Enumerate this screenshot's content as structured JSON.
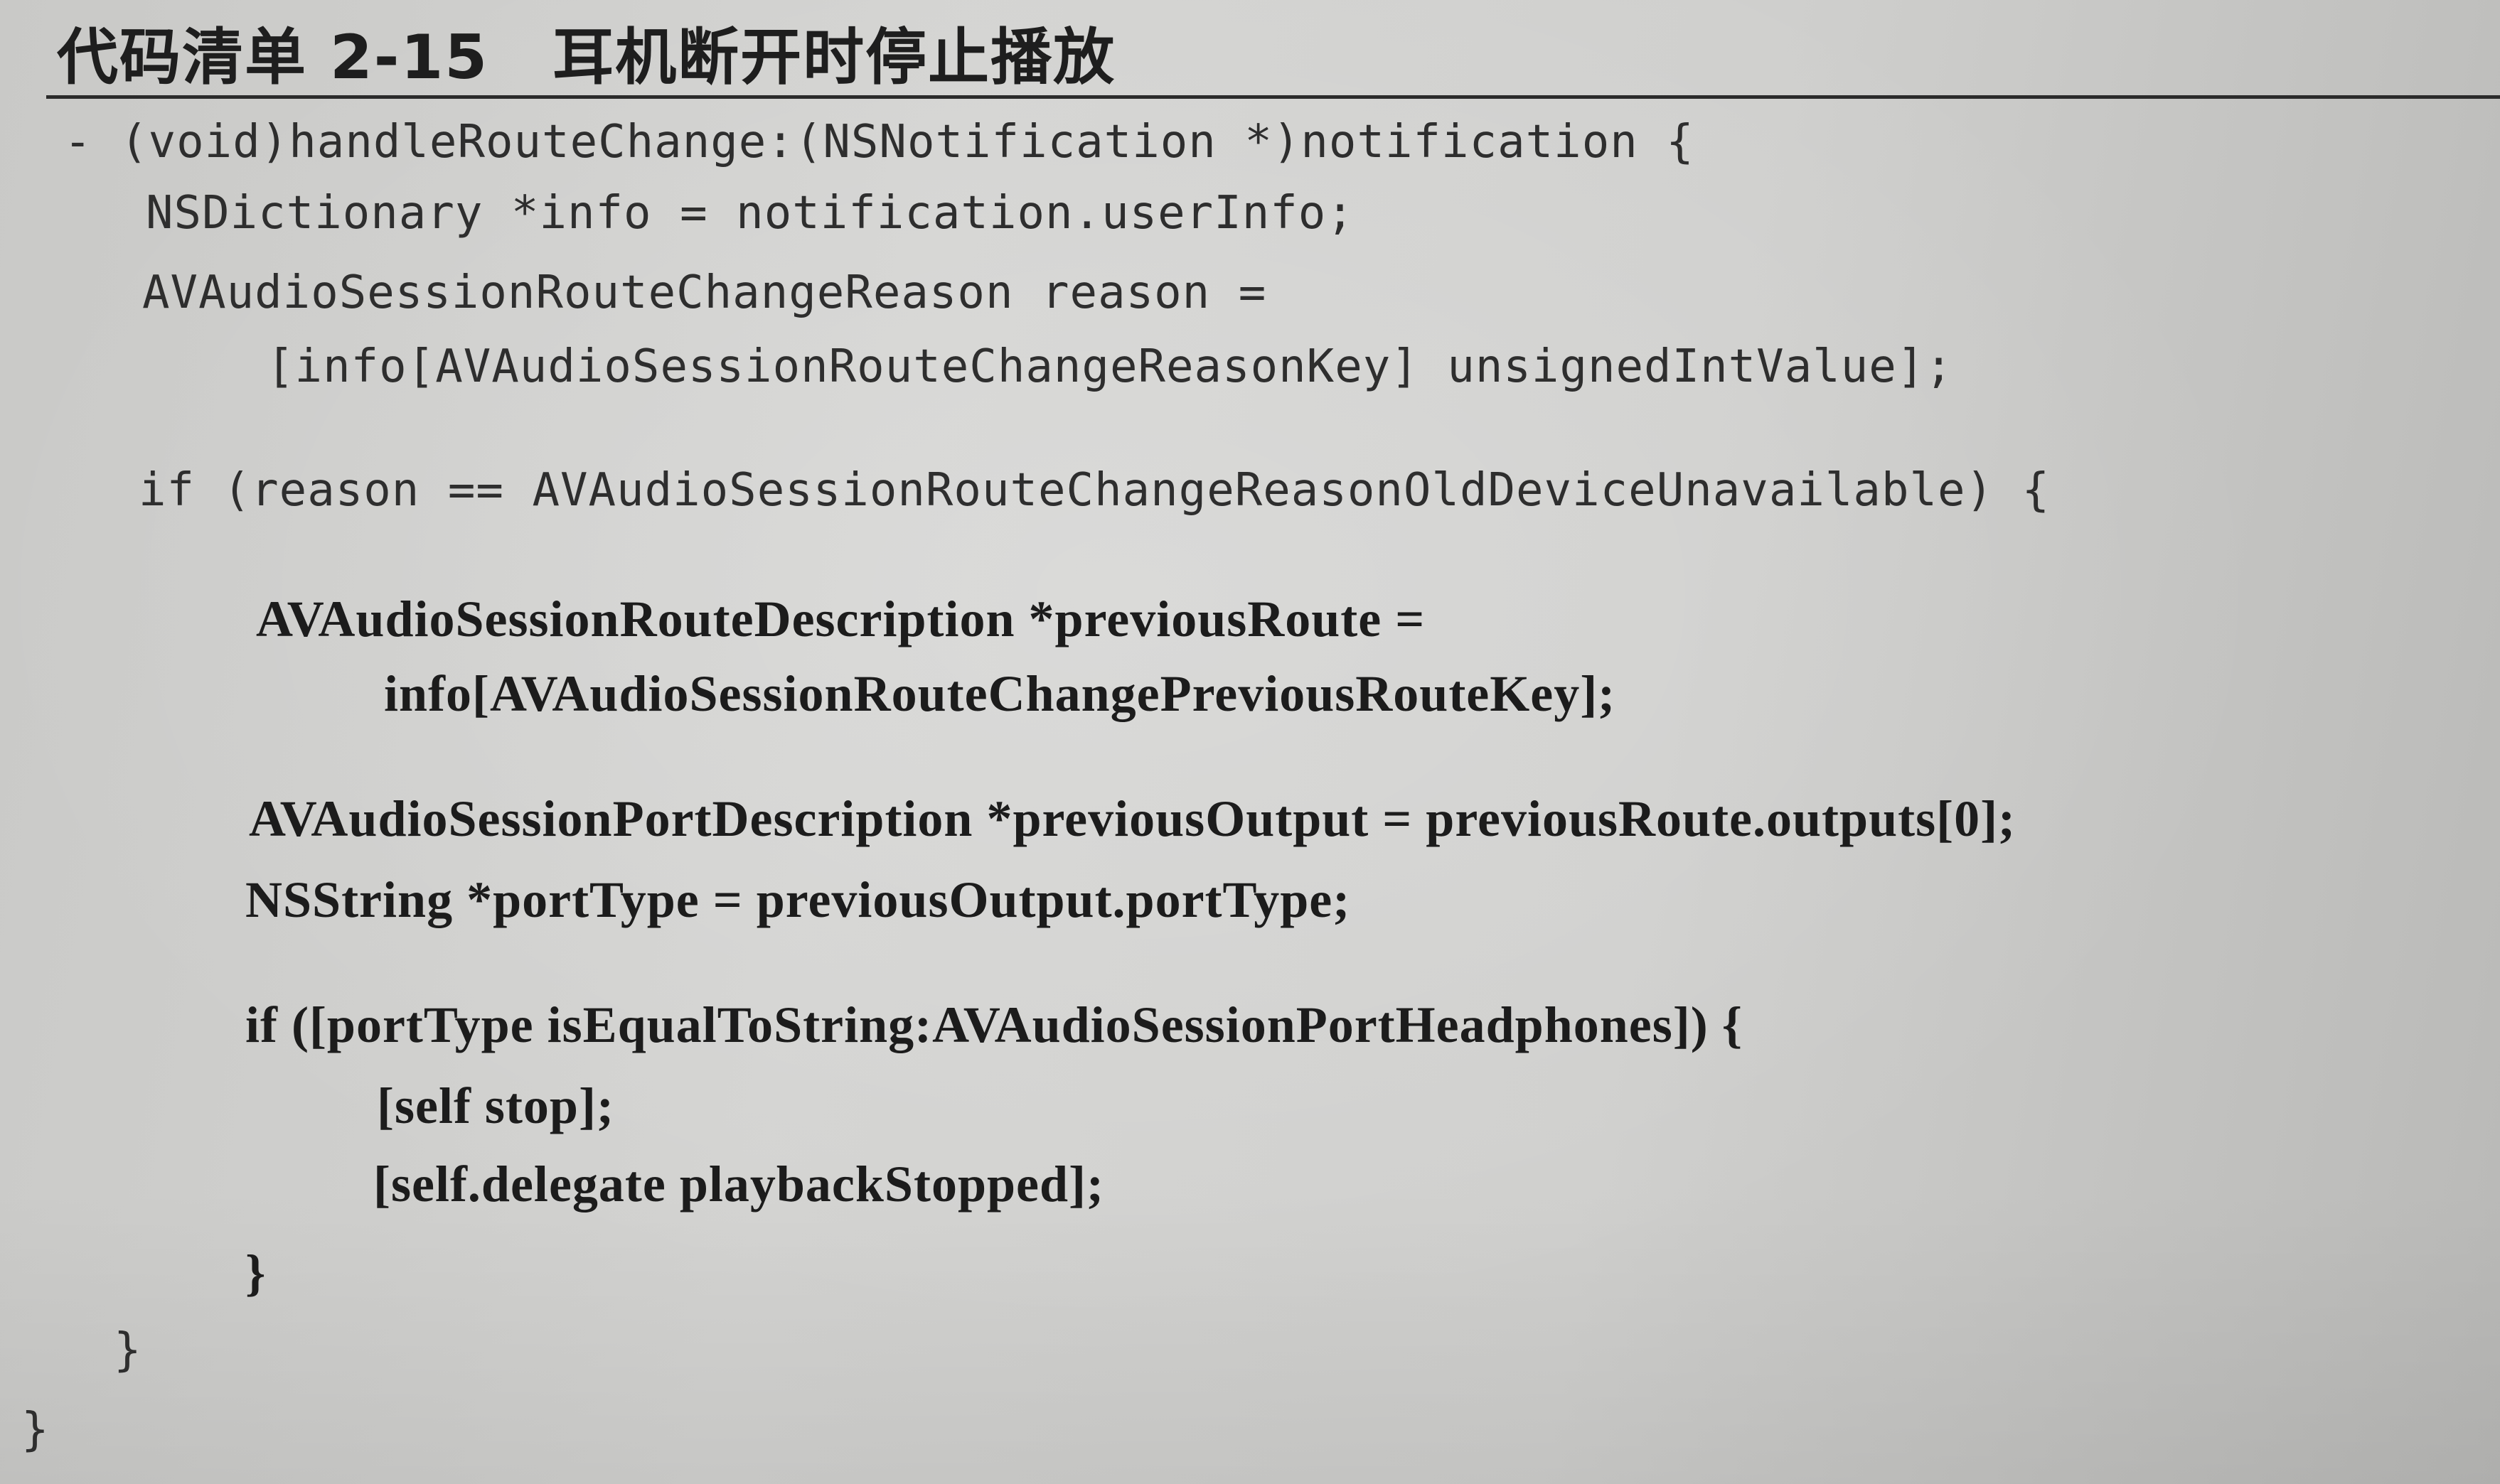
{
  "listing": {
    "label": "代码清单 2-15",
    "caption": "耳机断开时停止播放"
  },
  "code": {
    "lines": [
      "- (void)handleRouteChange:(NSNotification *)notification {",
      "NSDictionary *info = notification.userInfo;",
      "AVAudioSessionRouteChangeReason reason =",
      "[info[AVAudioSessionRouteChangeReasonKey] unsignedIntValue];",
      "if (reason == AVAudioSessionRouteChangeReasonOldDeviceUnavailable) {",
      "AVAudioSessionRouteDescription *previousRoute =",
      "info[AVAudioSessionRouteChangePreviousRouteKey];",
      "AVAudioSessionPortDescription *previousOutput = previousRoute.outputs[0];",
      "NSString *portType = previousOutput.portType;",
      "if ([portType isEqualToString:AVAudioSessionPortHeadphones]) {",
      "[self stop];",
      "[self.delegate playbackStopped];",
      "}",
      "}",
      "}"
    ]
  }
}
